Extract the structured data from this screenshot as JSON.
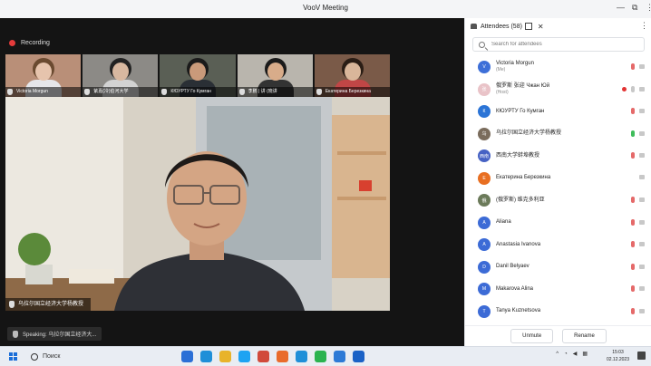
{
  "window": {
    "title": "VooV Meeting",
    "minimize": "—",
    "restore": "⧉",
    "more": "⋮"
  },
  "meeting": {
    "recording_label": "Recording",
    "thumbnails": [
      {
        "name": "Victoria Morgun",
        "bg": "#b98f78",
        "face": "#e6c4ad",
        "hair": "#6a4a30",
        "shirt": "#e6e6ea"
      },
      {
        "name": "紫嘉(冷)伯河大学",
        "bg": "#8c8a86",
        "face": "#d8b8a0",
        "hair": "#222",
        "shirt": "#d2d2d2"
      },
      {
        "name": "КЮУРТУ Го Кумган",
        "bg": "#5a5f55",
        "face": "#c99a7a",
        "hair": "#1a1a1a",
        "shirt": "#2a2f35"
      },
      {
        "name": "李鹏 | 讲 (晓讲",
        "bg": "#b9b5ad",
        "face": "#d8ac8a",
        "hair": "#1b1b1b",
        "shirt": "#333"
      },
      {
        "name": "Екатерина Березкина",
        "bg": "#7a5a48",
        "face": "#d9b69a",
        "hair": "#2a1d15",
        "shirt": "#c04646"
      }
    ],
    "main_speaker_label": "乌拉尔国立经济大学杨教授",
    "speaking_label": "Speaking: 乌拉尔国立经济大..."
  },
  "attendees": {
    "header": "Attendees (58)",
    "search_placeholder": "Search for attendees",
    "list": [
      {
        "name": "Victoria Morgun",
        "role": "(Me)",
        "initial": "V",
        "color": "#3d6fd8",
        "mic": "muted"
      },
      {
        "name": "俄罗斯 张迎 Чжан Юй",
        "role": "(Host)",
        "initial": "张",
        "color": "#e9c3c8",
        "mic": "rec"
      },
      {
        "name": "КЮУРТУ Го Кумган",
        "role": "",
        "initial": "К",
        "color": "#2b74d6",
        "mic": "muted"
      },
      {
        "name": "乌拉尔国立经济大学杨教授",
        "role": "",
        "initial": "乌",
        "color": "#7a6c5c",
        "mic": "live"
      },
      {
        "name": "西南大学蚌埠教授",
        "role": "",
        "initial": "西南",
        "color": "#4662c4",
        "mic": "muted"
      },
      {
        "name": "Екатерина Березкина",
        "role": "",
        "initial": "E",
        "color": "#e86f22",
        "mic": "none"
      },
      {
        "name": "(俄罗斯) 维克多利亚",
        "role": "",
        "initial": "俄",
        "color": "#6b7a5a",
        "mic": "muted"
      },
      {
        "name": "Aliana",
        "role": "",
        "initial": "A",
        "color": "#3c6bd6",
        "mic": "muted"
      },
      {
        "name": "Anastasia Ivanova",
        "role": "",
        "initial": "A",
        "color": "#3c6bd6",
        "mic": "muted"
      },
      {
        "name": "Danil Belyaev",
        "role": "",
        "initial": "D",
        "color": "#3c6bd6",
        "mic": "muted"
      },
      {
        "name": "Makarova Alina",
        "role": "",
        "initial": "M",
        "color": "#3c6bd6",
        "mic": "muted"
      },
      {
        "name": "Tanya Kuznetsova",
        "role": "",
        "initial": "T",
        "color": "#3c6bd6",
        "mic": "muted"
      }
    ],
    "unmute_label": "Unmute",
    "rename_label": "Rename"
  },
  "taskbar": {
    "search_text": "Поиск",
    "time": "15:03",
    "date": "02.12.2023",
    "apps": [
      "#2b6fd6",
      "#1f8fd8",
      "#e8b32a",
      "#1ea3f2",
      "#d14a3b",
      "#e96b2b",
      "#1f8fd8",
      "#2bb34f",
      "#2d7ad6",
      "#1b62c6"
    ]
  }
}
